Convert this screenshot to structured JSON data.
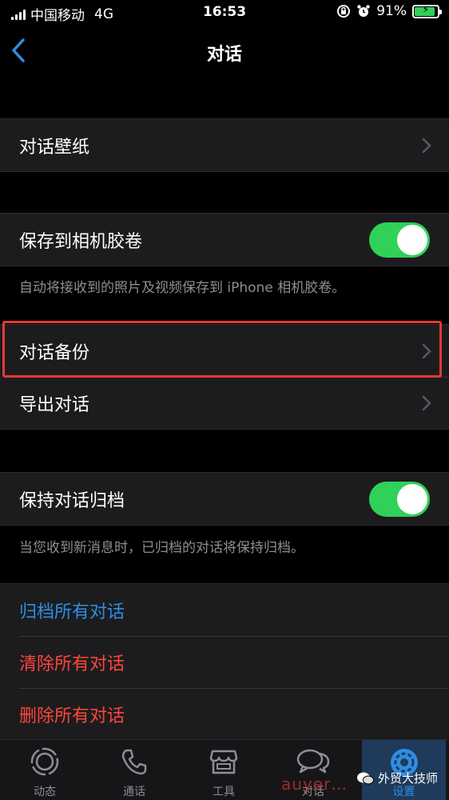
{
  "status_bar": {
    "carrier": "中国移动",
    "network": "4G",
    "time": "16:53",
    "battery": "91%",
    "battery_level": 0.91
  },
  "nav": {
    "title": "对话"
  },
  "sections": {
    "wallpaper": {
      "label": "对话壁纸"
    },
    "save_to_camera_roll": {
      "label": "保存到相机胶卷",
      "enabled": true,
      "note": "自动将接收到的照片及视频保存到 iPhone 相机胶卷。"
    },
    "chat_backup": {
      "label": "对话备份"
    },
    "export_chat": {
      "label": "导出对话"
    },
    "keep_chats_archived": {
      "label": "保持对话归档",
      "enabled": true,
      "note": "当您收到新消息时，已归档的对话将保持归档。"
    },
    "actions": {
      "archive_all": "归档所有对话",
      "clear_all": "清除所有对话",
      "delete_all": "删除所有对话"
    }
  },
  "tabs": [
    {
      "label": "动态",
      "icon": "status-icon"
    },
    {
      "label": "通话",
      "icon": "phone-icon"
    },
    {
      "label": "工具",
      "icon": "store-icon"
    },
    {
      "label": "对话",
      "icon": "chat-bubbles-icon"
    },
    {
      "label": "设置",
      "icon": "gear-icon",
      "active": true
    }
  ],
  "watermark": {
    "text": "外贸大技师",
    "logo_text": "auyer"
  },
  "colors": {
    "background": "#000000",
    "cell_background": "#1c1c1e",
    "toggle_on": "#30d158",
    "link_blue": "#2f8de4",
    "destructive_red": "#ff453a",
    "highlight_red": "#e53935"
  }
}
